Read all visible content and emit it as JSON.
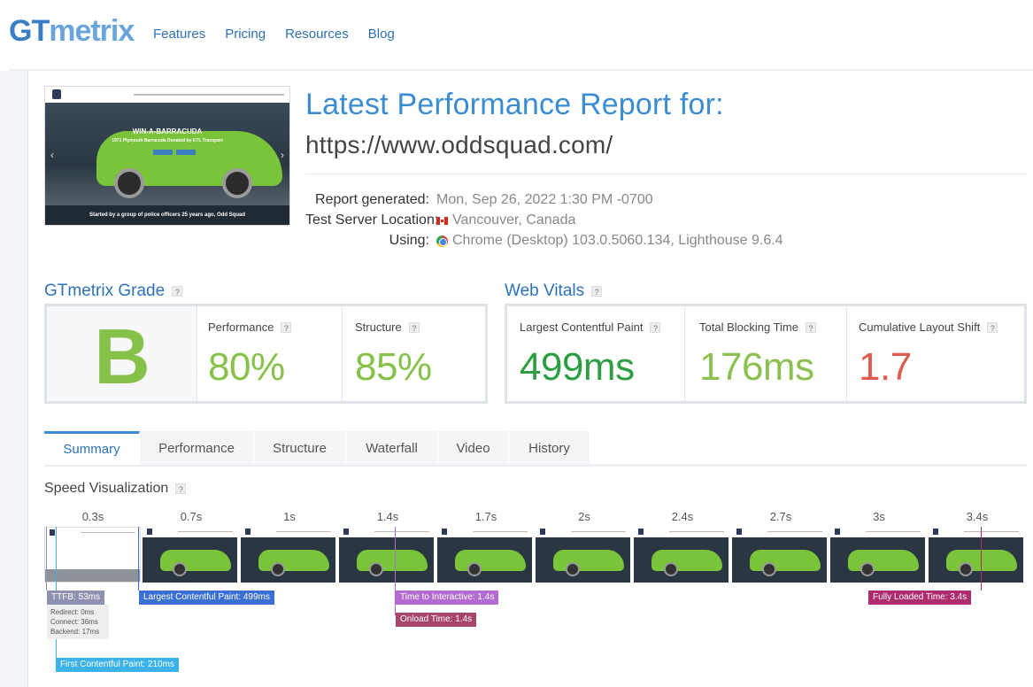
{
  "header": {
    "logo_gt": "GT",
    "logo_metrix": "metrix",
    "nav": [
      "Features",
      "Pricing",
      "Resources",
      "Blog"
    ]
  },
  "thumbnail": {
    "headline": "WIN-A-BARRACUDA",
    "subline": "1971 Plymouth Barracuda Donated by KTL Transport",
    "footer": "Started by a group of police officers 25 years ago, Odd Squad"
  },
  "report": {
    "title": "Latest Performance Report for:",
    "url": "https://www.oddsquad.com/",
    "generated_label": "Report generated:",
    "generated_value": "Mon, Sep 26, 2022 1:30 PM -0700",
    "server_label": "Test Server Location:",
    "server_value": "Vancouver, Canada",
    "using_label": "Using:",
    "using_value": "Chrome (Desktop) 103.0.5060.134, Lighthouse 9.6.4"
  },
  "grade": {
    "title": "GTmetrix Grade",
    "letter": "B",
    "performance_label": "Performance",
    "performance_value": "80%",
    "structure_label": "Structure",
    "structure_value": "85%"
  },
  "vitals": {
    "title": "Web Vitals",
    "lcp_label": "Largest Contentful Paint",
    "lcp_value": "499ms",
    "tbt_label": "Total Blocking Time",
    "tbt_value": "176ms",
    "cls_label": "Cumulative Layout Shift",
    "cls_value": "1.7"
  },
  "tabs": [
    "Summary",
    "Performance",
    "Structure",
    "Waterfall",
    "Video",
    "History"
  ],
  "active_tab": "Summary",
  "speed": {
    "title": "Speed Visualization",
    "times": [
      "0.3s",
      "0.7s",
      "1s",
      "1.4s",
      "1.7s",
      "2s",
      "2.4s",
      "2.7s",
      "3s",
      "3.4s"
    ],
    "ttfb": "TTFB: 53ms",
    "ttfb_redirect": "Redirect: 0ms",
    "ttfb_connect": "Connect: 36ms",
    "ttfb_backend": "Backend: 17ms",
    "lcp": "Largest Contentful Paint: 499ms",
    "tti": "Time to Interactive: 1.4s",
    "onload": "Onload Time: 1.4s",
    "fully_loaded": "Fully Loaded Time: 3.4s",
    "fcp": "First Contentful Paint: 210ms"
  },
  "help_mark": "?",
  "colors": {
    "brand_blue": "#3a8dd4",
    "grade_green": "#86c24a",
    "good_green": "#2e9e43",
    "ok_green": "#8cc152",
    "bad_red": "#e05a4f",
    "ttfb": "#8e91b0",
    "lcp": "#3a6fd6",
    "tti": "#b36bd1",
    "onload": "#a8456b",
    "fully_loaded": "#b02b6e",
    "fcp": "#3bb2ea"
  }
}
